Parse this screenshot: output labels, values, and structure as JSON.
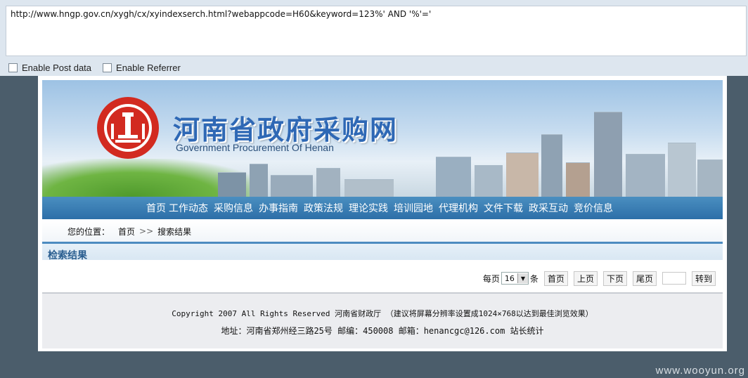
{
  "address_bar": {
    "url": "http://www.hngp.gov.cn/xygh/cx/xyindexserch.html?webappcode=H60&keyword=123%' AND '%'='"
  },
  "options": {
    "post_label": "Enable Post data",
    "referrer_label": "Enable Referrer"
  },
  "header": {
    "title_cn": "河南省政府采购网",
    "title_en": "Government Procurement Of Henan"
  },
  "nav": {
    "items": [
      "首页",
      "工作动态",
      "采购信息",
      "办事指南",
      "政策法规",
      "理论实践",
      "培训园地",
      "代理机构",
      "文件下载",
      "政采互动",
      "竞价信息"
    ]
  },
  "breadcrumb": {
    "label": "您的位置：",
    "home": "首页",
    "separator": ">>",
    "current": "搜索结果"
  },
  "results": {
    "title": "检索结果"
  },
  "pager": {
    "per_page_label": "每页",
    "per_page_value": "16",
    "per_page_unit": "条",
    "first": "首页",
    "prev": "上页",
    "next": "下页",
    "last": "尾页",
    "go": "转到"
  },
  "footer": {
    "copyright": "Copyright 2007 All Rights Reserved 河南省财政厅 （建议将屏幕分辨率设置成1024×768以达到最佳浏览效果）",
    "address": "地址：河南省郑州经三路25号 邮编：450008 邮箱：henancgc@126.com  站长统计"
  },
  "watermark": "www.wooyun.org"
}
